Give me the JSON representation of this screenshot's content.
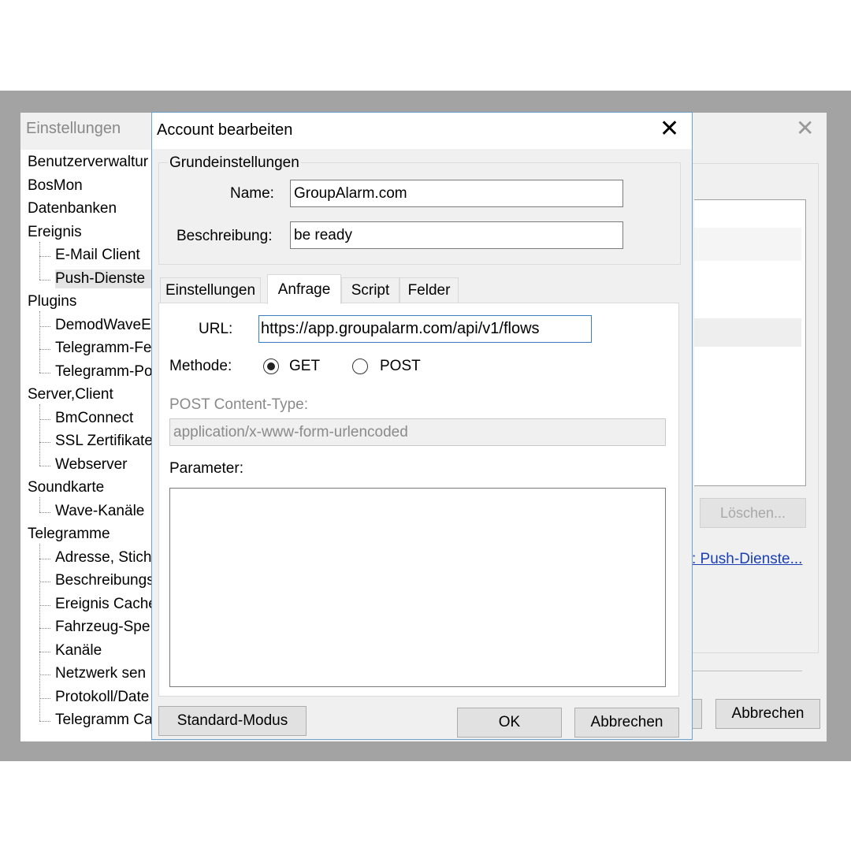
{
  "background_window": {
    "title": "Einstellungen",
    "tree": [
      {
        "label": "Benutzerverwaltur",
        "level": 0
      },
      {
        "label": "BosMon",
        "level": 0
      },
      {
        "label": "Datenbanken",
        "level": 0
      },
      {
        "label": "Ereignis",
        "level": 0
      },
      {
        "label": "E-Mail Client",
        "level": 1
      },
      {
        "label": "Push-Dienste",
        "level": 1,
        "selected": true
      },
      {
        "label": "Plugins",
        "level": 0
      },
      {
        "label": "DemodWaveE",
        "level": 1
      },
      {
        "label": "Telegramm-Fe",
        "level": 1
      },
      {
        "label": "Telegramm-Po",
        "level": 1
      },
      {
        "label": "Server,Client",
        "level": 0
      },
      {
        "label": "BmConnect",
        "level": 1
      },
      {
        "label": "SSL Zertifikate",
        "level": 1
      },
      {
        "label": "Webserver",
        "level": 1
      },
      {
        "label": "Soundkarte",
        "level": 0
      },
      {
        "label": "Wave-Kanäle",
        "level": 1
      },
      {
        "label": "Telegramme",
        "level": 0
      },
      {
        "label": "Adresse, Stich",
        "level": 1
      },
      {
        "label": "Beschreibungs",
        "level": 1
      },
      {
        "label": "Ereignis Cache",
        "level": 1
      },
      {
        "label": "Fahrzeug-Spe",
        "level": 1
      },
      {
        "label": "Kanäle",
        "level": 1
      },
      {
        "label": "Netzwerk sen",
        "level": 1
      },
      {
        "label": "Protokoll/Date",
        "level": 1
      },
      {
        "label": "Telegramm Ca",
        "level": 1
      }
    ],
    "delete_button": "Löschen...",
    "link_text": ": Push-Dienste...",
    "cancel_button": "Abbrechen"
  },
  "dialog": {
    "title": "Account bearbeiten",
    "group_title": "Grundeinstellungen",
    "name_label": "Name:",
    "name_value": "GroupAlarm.com",
    "desc_label": "Beschreibung:",
    "desc_value": "be ready",
    "tabs": [
      {
        "label": "Einstellungen",
        "active": false
      },
      {
        "label": "Anfrage",
        "active": true
      },
      {
        "label": "Script",
        "active": false
      },
      {
        "label": "Felder",
        "active": false
      }
    ],
    "url_label": "URL:",
    "url_value": "https://app.groupalarm.com/api/v1/flows",
    "method_label": "Methode:",
    "method_options": [
      "GET",
      "POST"
    ],
    "method_selected": "GET",
    "content_type_label": "POST Content-Type:",
    "content_type_value": "application/x-www-form-urlencoded",
    "parameter_label": "Parameter:",
    "parameter_value": "",
    "standard_mode_button": "Standard-Modus",
    "ok_button": "OK",
    "cancel_button": "Abbrechen"
  }
}
